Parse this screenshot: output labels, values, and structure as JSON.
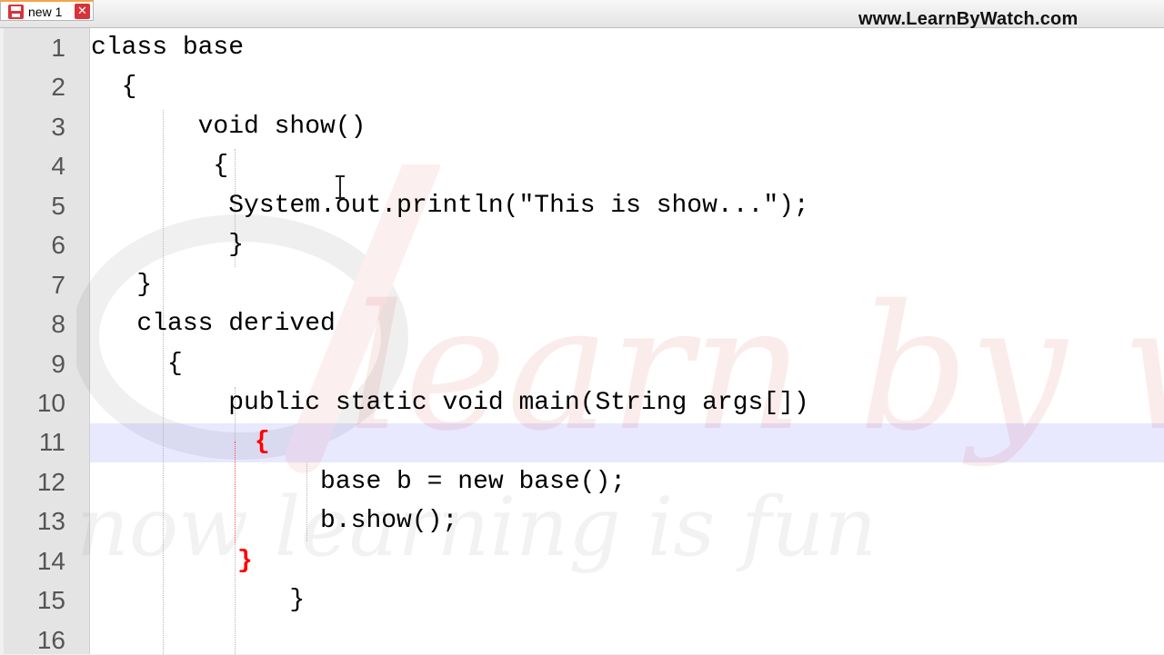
{
  "tab": {
    "label": "new 1"
  },
  "header": {
    "site": "www.LearnByWatch.com"
  },
  "editor": {
    "lines": [
      {
        "num": "1",
        "text": "class base"
      },
      {
        "num": "2",
        "text": "  {"
      },
      {
        "num": "3",
        "text": "       void show()"
      },
      {
        "num": "4",
        "text": "        {"
      },
      {
        "num": "5",
        "text": "         System.out.println(\"This is show...\");"
      },
      {
        "num": "6",
        "text": "         }"
      },
      {
        "num": "7",
        "text": "   }"
      },
      {
        "num": "8",
        "text": "   class derived"
      },
      {
        "num": "9",
        "text": "     {"
      },
      {
        "num": "10",
        "text": "         public static void main(String args[])"
      },
      {
        "num": "11",
        "text": "{"
      },
      {
        "num": "12",
        "text": "               base b = new base();"
      },
      {
        "num": "13",
        "text": "               b.show();"
      },
      {
        "num": "14",
        "text": "}"
      },
      {
        "num": "15",
        "text": "             }"
      },
      {
        "num": "16",
        "text": ""
      }
    ]
  },
  "watermark": {
    "main": "learn by watch",
    "tagline": "now learning is fun"
  },
  "colors": {
    "current_line": "#e8e8ff",
    "brace_match": "#ff0000",
    "gutter": "#e4e4e4"
  },
  "icons": [
    "save-icon",
    "close-icon",
    "cd-logo-icon",
    "text-cursor-icon"
  ]
}
